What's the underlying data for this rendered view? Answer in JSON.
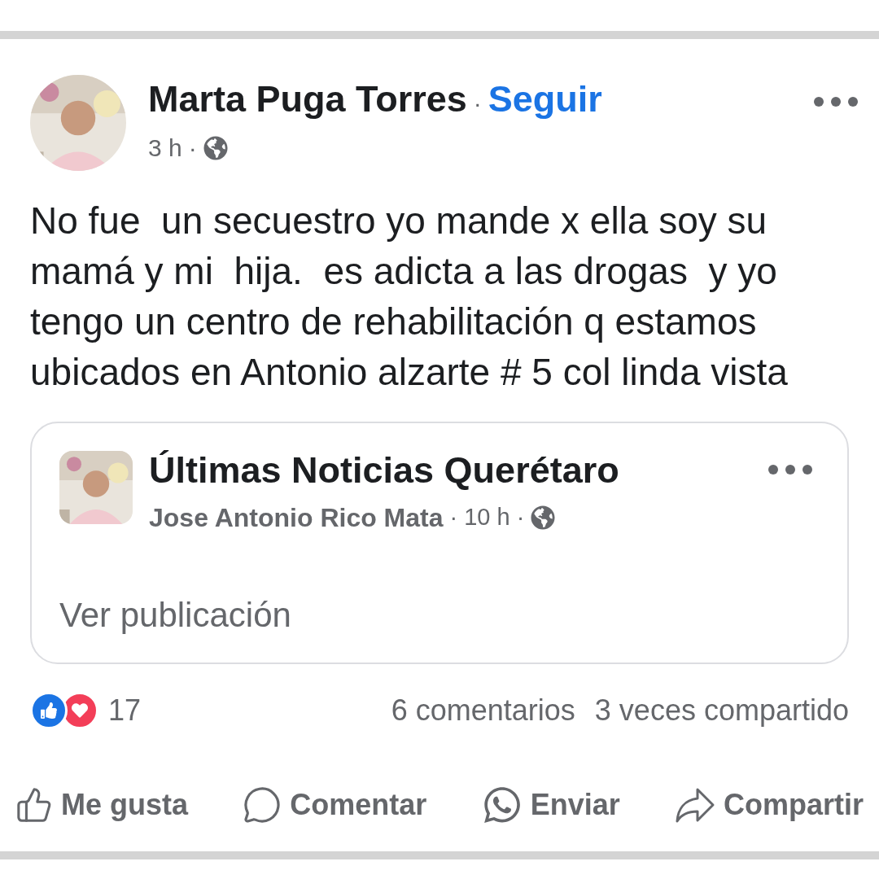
{
  "post": {
    "author": "Marta Puga Torres",
    "separator_1": "·",
    "follow": "Seguir",
    "time": "3 h",
    "separator_2": "·",
    "text": "No fue  un secuestro yo mande x ella soy su mamá y mi  hija.  es adicta a las drogas  y yo tengo un centro de rehabilitación q estamos ubicados en Antonio alzarte # 5 col linda vista",
    "shared": {
      "page": "Últimas Noticias Querétaro",
      "author": "Jose Antonio Rico Mata",
      "separator_1": "·",
      "time": "10 h",
      "separator_2": "·",
      "link": "Ver publicación"
    },
    "stats": {
      "count": "17",
      "comments": "6 comentarios",
      "shares": "3 veces compartido"
    },
    "actions": [
      {
        "kind": "like",
        "label": "Me gusta"
      },
      {
        "kind": "comment",
        "label": "Comentar"
      },
      {
        "kind": "send",
        "label": "Enviar"
      },
      {
        "kind": "share",
        "label": "Compartir"
      }
    ]
  }
}
